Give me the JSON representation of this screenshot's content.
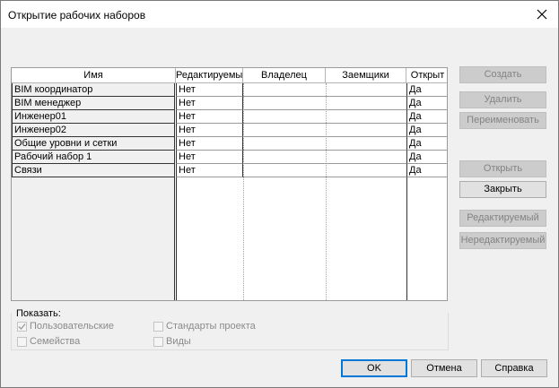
{
  "window": {
    "title": "Открытие рабочих наборов"
  },
  "grid": {
    "columns": [
      "Имя",
      "Редактируемый",
      "Владелец",
      "Заемщики",
      "Открыт"
    ],
    "rows": [
      {
        "name": "BIM координатор",
        "editable": "Нет",
        "owner": "",
        "borrowers": "",
        "open": "Да"
      },
      {
        "name": "BIM менеджер",
        "editable": "Нет",
        "owner": "",
        "borrowers": "",
        "open": "Да"
      },
      {
        "name": "Инженер01",
        "editable": "Нет",
        "owner": "",
        "borrowers": "",
        "open": "Да"
      },
      {
        "name": "Инженер02",
        "editable": "Нет",
        "owner": "",
        "borrowers": "",
        "open": "Да"
      },
      {
        "name": "Общие уровни и сетки",
        "editable": "Нет",
        "owner": "",
        "borrowers": "",
        "open": "Да"
      },
      {
        "name": "Рабочий набор 1",
        "editable": "Нет",
        "owner": "",
        "borrowers": "",
        "open": "Да"
      },
      {
        "name": "Связи",
        "editable": "Нет",
        "owner": "",
        "borrowers": "",
        "open": "Да"
      }
    ]
  },
  "side_buttons": {
    "create": "Создать",
    "delete": "Удалить",
    "rename": "Переименовать",
    "open": "Открыть",
    "close": "Закрыть",
    "editable": "Редактируемый",
    "non_editable": "Нередактируемый"
  },
  "show": {
    "label": "Показать:",
    "user_defined": {
      "label": "Пользовательские",
      "checked": true
    },
    "families": {
      "label": "Семейства",
      "checked": false
    },
    "project_standards": {
      "label": "Стандарты проекта",
      "checked": false
    },
    "views": {
      "label": "Виды",
      "checked": false
    }
  },
  "footer": {
    "ok": "OK",
    "cancel": "Отмена",
    "help": "Справка"
  },
  "colors": {
    "accent": "#0078d7",
    "disabled_text": "#838383"
  }
}
